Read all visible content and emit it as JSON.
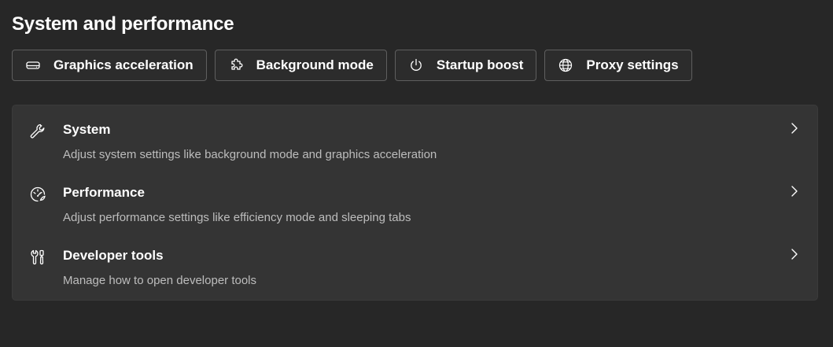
{
  "page": {
    "title": "System and performance"
  },
  "chips": [
    {
      "label": "Graphics acceleration",
      "icon": "drive-icon"
    },
    {
      "label": "Background mode",
      "icon": "puzzle-icon"
    },
    {
      "label": "Startup boost",
      "icon": "power-icon"
    },
    {
      "label": "Proxy settings",
      "icon": "globe-icon"
    }
  ],
  "settings": [
    {
      "title": "System",
      "description": "Adjust system settings like background mode and graphics acceleration",
      "icon": "wrench-icon"
    },
    {
      "title": "Performance",
      "description": "Adjust performance settings like efficiency mode and sleeping tabs",
      "icon": "performance-icon"
    },
    {
      "title": "Developer tools",
      "description": "Manage how to open developer tools",
      "icon": "developer-tools-icon"
    }
  ],
  "colors": {
    "background": "#272727",
    "card": "#343434",
    "text": "#ffffff",
    "secondary_text": "#bdbdbd",
    "chip_border": "#5f5f5f"
  }
}
